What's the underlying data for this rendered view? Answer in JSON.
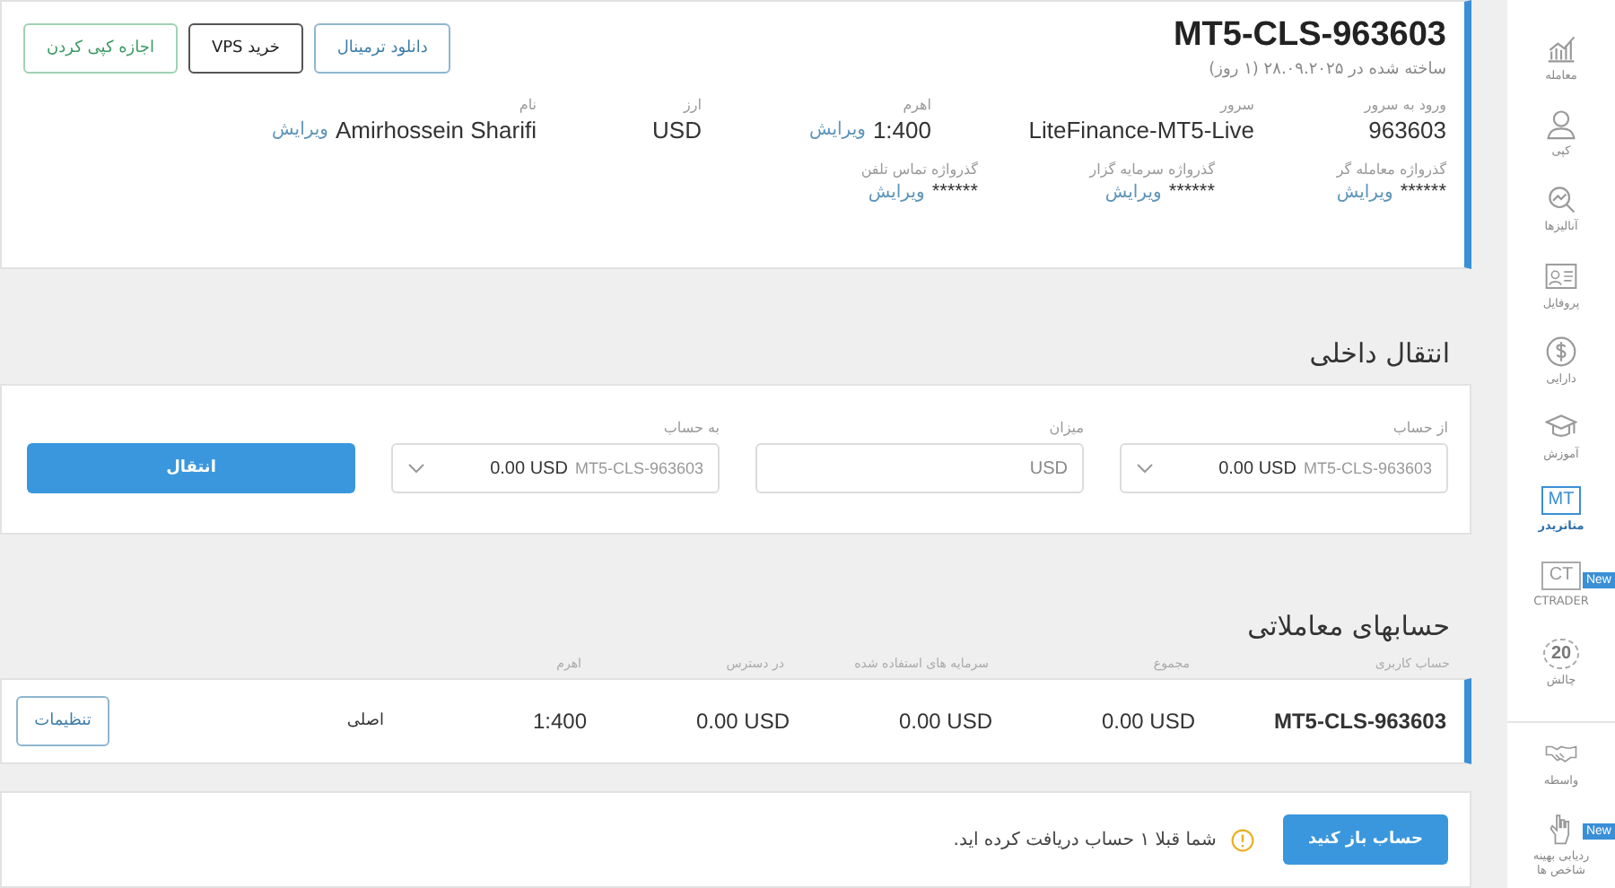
{
  "account": {
    "title": "MT5-CLS-963603",
    "created": "ساخته شده در ۲۸.۰۹.۲۰۲۵ (۱ روز)",
    "buttons": [
      {
        "label": "دانلود ترمینال",
        "kind": "primary"
      },
      {
        "label": "خرید VPS",
        "kind": "dark"
      },
      {
        "label": "اجازه کپی کردن",
        "kind": "green"
      }
    ],
    "fields": [
      {
        "label": "ورود به سرور",
        "value": "963603"
      },
      {
        "label": "سرور",
        "value": "LiteFinance-MT5-Live"
      },
      {
        "label": "اهرم",
        "value": "1:400",
        "edit": "ویرایش"
      },
      {
        "label": "ارز",
        "value": "USD"
      },
      {
        "label": "نام",
        "value": "Amirhossein Sharifi",
        "edit": "ویرایش"
      }
    ],
    "passwords": [
      {
        "label": "گذرواژه معامله گر",
        "value": "******",
        "edit": "ویرایش"
      },
      {
        "label": "گذرواژه سرمایه گزار",
        "value": "******",
        "edit": "ویرایش"
      },
      {
        "label": "گذرواژه تماس تلفن",
        "value": "******",
        "edit": "ویرایش"
      }
    ]
  },
  "transfer": {
    "heading": "انتقال داخلی",
    "fields": [
      {
        "kind": "select",
        "label": "از حساب",
        "value": "0.00 USD",
        "account": "MT5-CLS-963603"
      },
      {
        "kind": "input",
        "label": "میزان",
        "placeholder": "USD"
      },
      {
        "kind": "select",
        "label": "به حساب",
        "value": "0.00 USD",
        "account": "MT5-CLS-963603"
      }
    ],
    "button": "انتقال"
  },
  "accounts": {
    "heading": "حسابهای معاملاتی",
    "columns": [
      "حساب کاربری",
      "مجموع",
      "سرمایه های استفاده شده",
      "در دسترس",
      "اهرم"
    ],
    "rows": [
      {
        "cells": [
          "MT5-CLS-963603",
          "0.00 USD",
          "0.00 USD",
          "0.00 USD",
          "1:400"
        ],
        "type": "اصلی",
        "settings": "تنظیمات"
      }
    ]
  },
  "notice": {
    "button": "حساب باز کنید",
    "message": "شما قبلا ۱ حساب دریافت کرده اید."
  },
  "sidebar": {
    "items": [
      {
        "kind": "chart",
        "label": "معامله",
        "selected": false
      },
      {
        "kind": "person",
        "label": "کپی",
        "selected": false
      },
      {
        "kind": "analysis",
        "label": "آنالیزها",
        "selected": false
      },
      {
        "kind": "profile",
        "label": "پروفایل",
        "selected": false
      },
      {
        "kind": "dollar",
        "label": "دارایی",
        "selected": false
      },
      {
        "kind": "cap",
        "label": "آموزش",
        "selected": false
      },
      {
        "kind": "mt",
        "mark": "MT",
        "label": "متاتریدر",
        "selected": true
      },
      {
        "kind": "ct",
        "mark": "CT",
        "label": "CTRADER",
        "selected": false,
        "badge": "New"
      },
      {
        "kind": "laurel",
        "mark": "20",
        "label": "چالش",
        "selected": false
      }
    ],
    "bottom_items": [
      {
        "kind": "handshake",
        "label": "واسطه",
        "selected": false
      },
      {
        "kind": "hand",
        "label": "ردیابی بهینه شاخص ها",
        "selected": false,
        "badge": "New"
      }
    ]
  }
}
